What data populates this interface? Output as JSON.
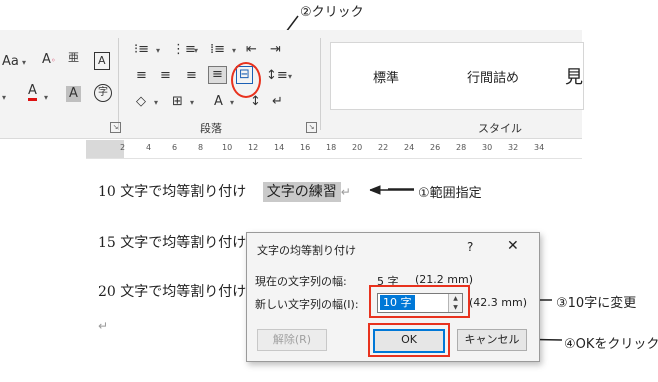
{
  "annotations": {
    "step2": "②クリック",
    "step1": "①範囲指定",
    "step3": "③10字に変更",
    "step4": "④OKをクリック"
  },
  "ribbon": {
    "font_size_label": "Aa",
    "groups": {
      "paragraph": "段落",
      "styles": "スタイル"
    },
    "styles_gallery": [
      "標準",
      "行間詰め",
      "見"
    ]
  },
  "ruler": {
    "ticks": [
      "2",
      "4",
      "6",
      "8",
      "10",
      "12",
      "14",
      "16",
      "18",
      "20",
      "22",
      "24",
      "26",
      "28",
      "30",
      "32",
      "34"
    ]
  },
  "document": {
    "line1_text": "10 文字で均等割り付け",
    "line1_selected": "文字の練習",
    "line2_text": "15 文字で均等割り付け",
    "line3_text": "20 文字で均等割り付け",
    "para_mark": "↵"
  },
  "dialog": {
    "title": "文字の均等割り付け",
    "help": "?",
    "close": "✕",
    "current_label": "現在の文字列の幅:",
    "current_value": "5 字",
    "current_mm": "(21.2 mm)",
    "new_label": "新しい文字列の幅(I):",
    "new_value": "10 字",
    "new_mm": "(42.3 mm)",
    "remove_button": "解除(R)",
    "ok_button": "OK",
    "cancel_button": "キャンセル"
  }
}
